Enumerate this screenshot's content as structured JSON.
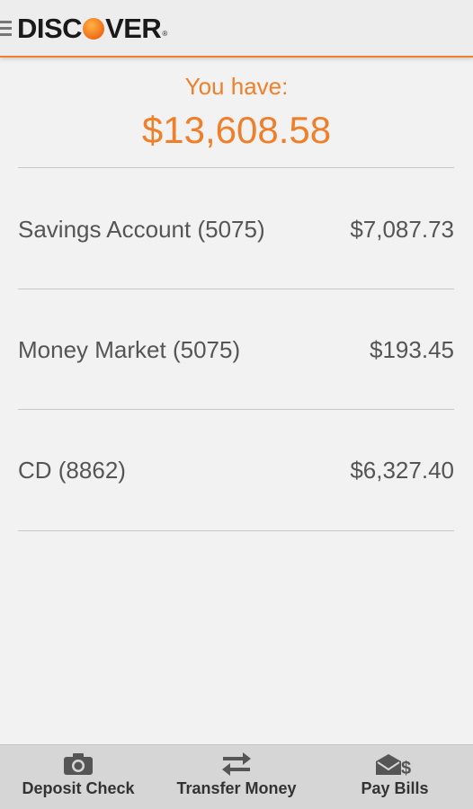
{
  "header": {
    "logo_left": "DISC",
    "logo_right": "VER",
    "logo_reg": "®"
  },
  "summary": {
    "label": "You have:",
    "total": "$13,608.58"
  },
  "accounts": [
    {
      "name": "Savings Account (5075)",
      "balance": "$7,087.73"
    },
    {
      "name": "Money Market (5075)",
      "balance": "$193.45"
    },
    {
      "name": "CD (8862)",
      "balance": "$6,327.40"
    }
  ],
  "bottom_bar": {
    "deposit": {
      "label": "Deposit Check",
      "icon": "camera-icon"
    },
    "transfer": {
      "label": "Transfer Money",
      "icon": "transfer-arrows-icon"
    },
    "pay": {
      "label": "Pay Bills",
      "icon": "envelope-dollar-icon"
    }
  },
  "colors": {
    "accent": "#f07f2a",
    "background": "#f2f2f2",
    "text": "#555555"
  }
}
